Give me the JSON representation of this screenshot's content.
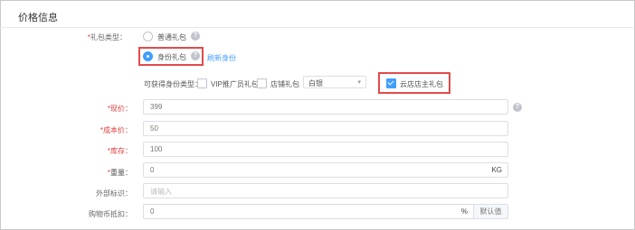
{
  "section_title": "价格信息",
  "gift_type": {
    "label": "*礼包类型：",
    "options": [
      {
        "label": "普通礼包",
        "selected": false
      },
      {
        "label": "身份礼包",
        "selected": true
      }
    ],
    "refresh_link": "刷新身份"
  },
  "identity": {
    "label": "可获得身份类型：",
    "options": [
      {
        "label": "VIP推广员礼包",
        "checked": false
      },
      {
        "label": "店铺礼包",
        "checked": false
      },
      {
        "label": "云店店主礼包",
        "checked": true
      }
    ],
    "select_value": "白银"
  },
  "fields": {
    "price": {
      "label": "*现价：",
      "value": "399"
    },
    "cost": {
      "label": "*成本价：",
      "value": "50"
    },
    "stock": {
      "label": "*库存：",
      "value": "100"
    },
    "weight": {
      "label": "*重量：",
      "value": "0",
      "unit": "KG"
    },
    "external_id": {
      "label": "外部标识：",
      "placeholder": "请输入"
    },
    "coin_deduct": {
      "label": "购物币抵扣：",
      "value": "0",
      "unit": "%",
      "default_button": "默认值"
    }
  },
  "colors": {
    "accent": "#409eff",
    "highlight_border": "#e24a4a",
    "required": "#e03c3c"
  }
}
